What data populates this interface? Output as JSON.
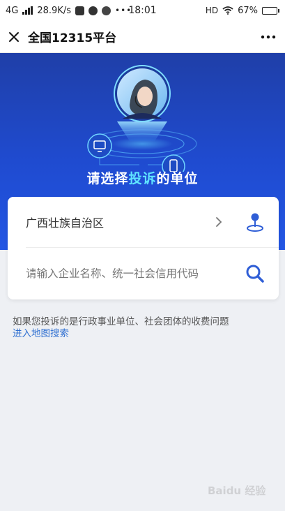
{
  "status_bar": {
    "network": "4G",
    "speed": "28.9K/s",
    "time": "18:01",
    "hd": "HD",
    "battery": "67%",
    "battery_level": 0.67
  },
  "header": {
    "title": "全国12315平台"
  },
  "hero": {
    "title_before": "请选择",
    "title_highlight": "投诉",
    "title_after": "的单位"
  },
  "form": {
    "region_label": "广西壮族自治区",
    "search_placeholder": "请输入企业名称、统一社会信用代码"
  },
  "note": {
    "text": "如果您投诉的是行政事业单位、社会团体的收费问题",
    "link": "进入地图搜索"
  },
  "watermark": {
    "text": "Baidu 经验"
  },
  "colors": {
    "hero_top": "#1f3fa8",
    "hero_bottom": "#2356e4",
    "highlight": "#5fe3ff",
    "link": "#2f6fd1",
    "icon_blue": "#2f5ed6"
  }
}
